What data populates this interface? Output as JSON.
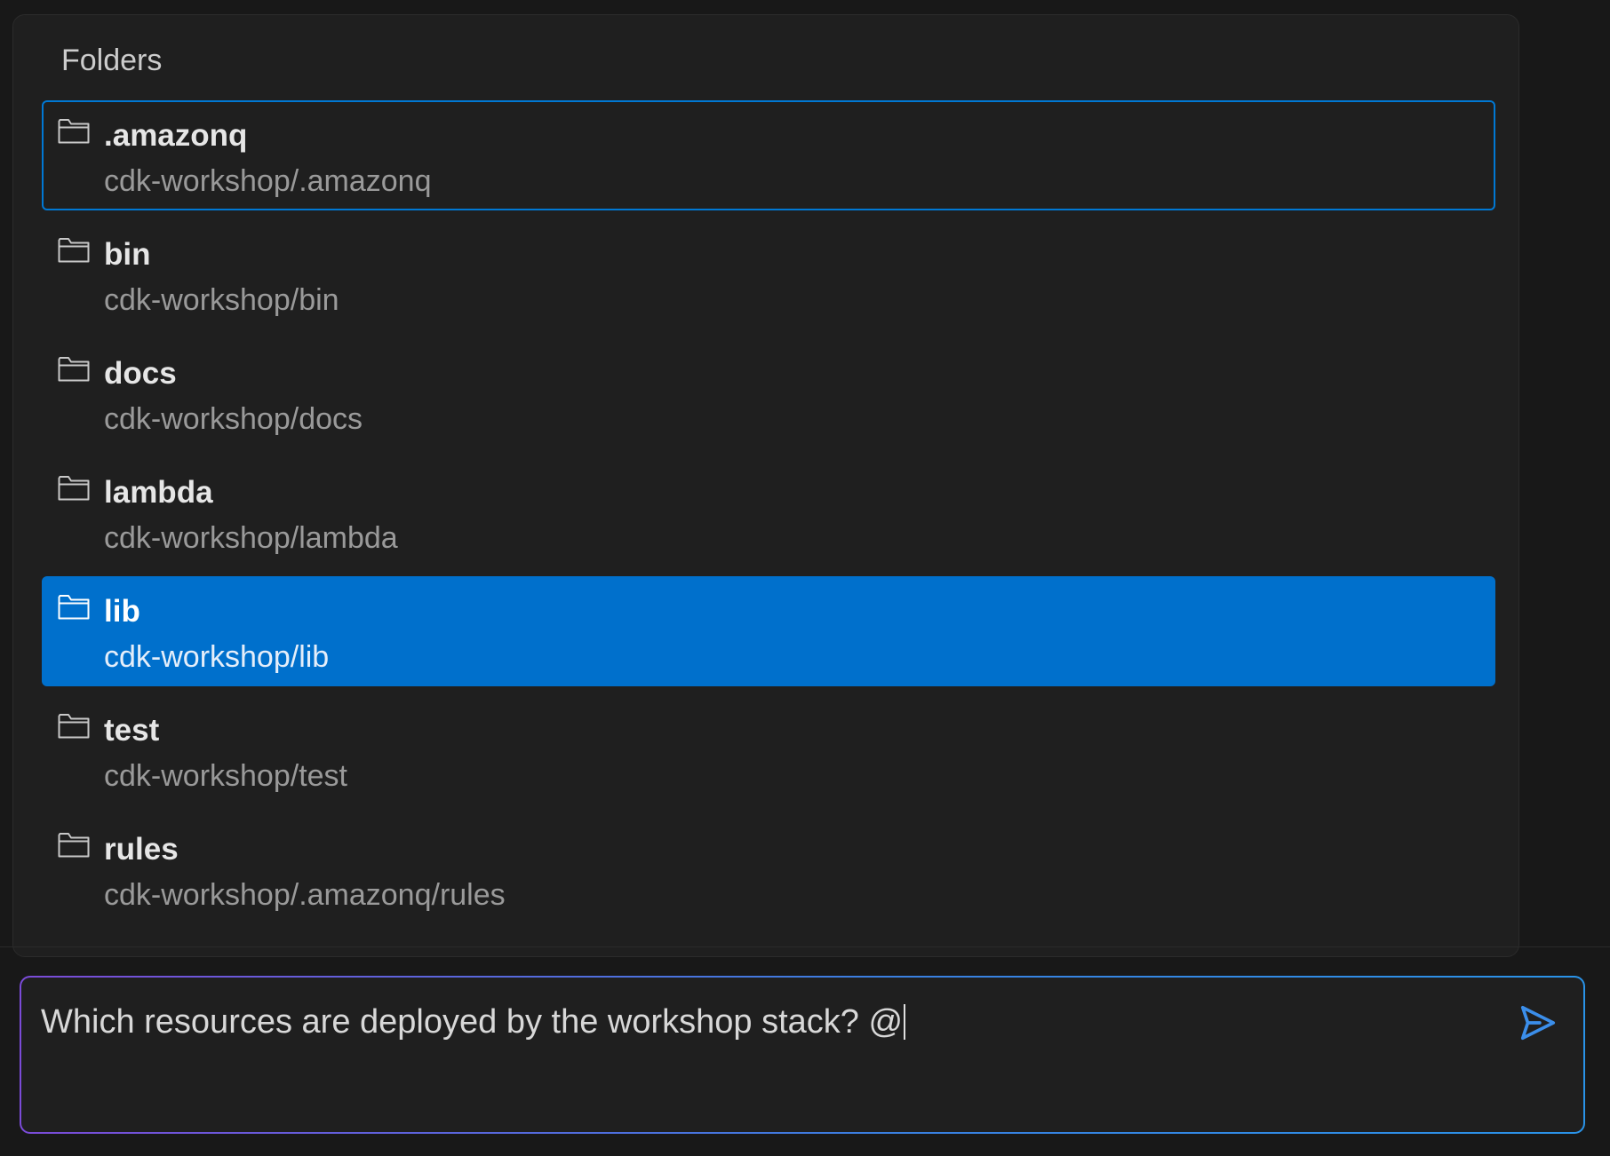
{
  "popup": {
    "header": "Folders",
    "items": [
      {
        "name": ".amazonq",
        "path": "cdk-workshop/.amazonq",
        "state": "focused",
        "icon": "folder-icon"
      },
      {
        "name": "bin",
        "path": "cdk-workshop/bin",
        "state": "normal",
        "icon": "folder-icon"
      },
      {
        "name": "docs",
        "path": "cdk-workshop/docs",
        "state": "normal",
        "icon": "folder-icon"
      },
      {
        "name": "lambda",
        "path": "cdk-workshop/lambda",
        "state": "normal",
        "icon": "folder-icon"
      },
      {
        "name": "lib",
        "path": "cdk-workshop/lib",
        "state": "selected",
        "icon": "folder-icon"
      },
      {
        "name": "test",
        "path": "cdk-workshop/test",
        "state": "normal",
        "icon": "folder-icon"
      },
      {
        "name": "rules",
        "path": "cdk-workshop/.amazonq/rules",
        "state": "normal",
        "icon": "folder-icon"
      }
    ]
  },
  "chat_input": {
    "value": "Which resources are deployed by the workshop stack? @",
    "send_icon": "send-icon"
  },
  "colors": {
    "background": "#181818",
    "panel": "#1f1f1f",
    "selected": "#0070cc",
    "focus_border": "#0078d4",
    "send_icon": "#3b8eea"
  }
}
